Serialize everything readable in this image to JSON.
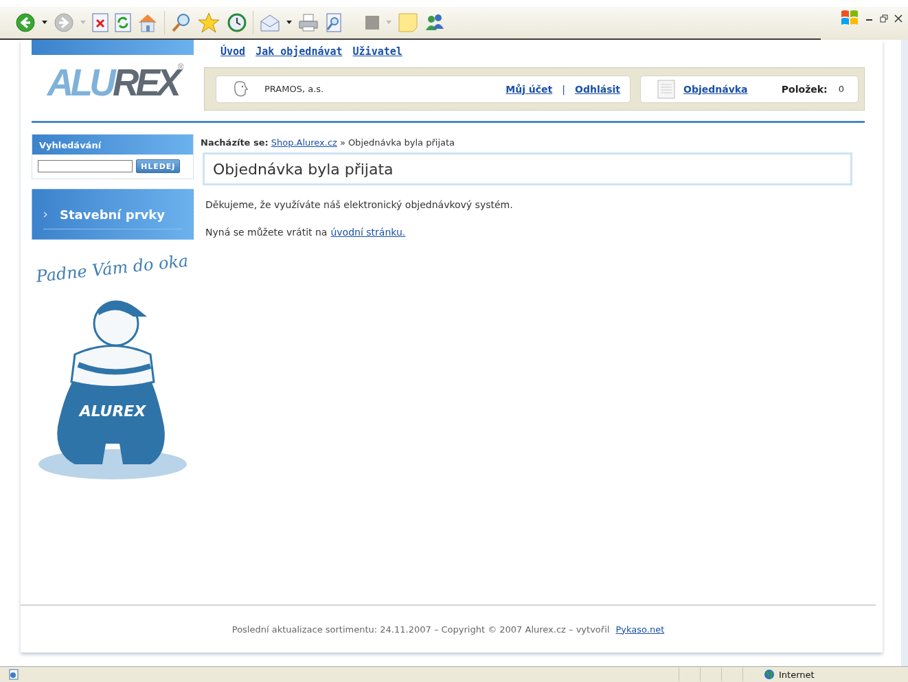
{
  "nav_links": [
    "Úvod",
    "Jak objednávat",
    "Uživatel"
  ],
  "logo": {
    "light_part": "ALU",
    "dark_part": "REX",
    "mark": "®"
  },
  "user_panel": {
    "company": "PRAMOS, a.s.",
    "links": [
      "Můj účet",
      "Odhlásit"
    ],
    "separator": "|"
  },
  "order_panel": {
    "link": "Objednávka",
    "count_label": "Položek:",
    "count": "0"
  },
  "search": {
    "title": "Vyhledávání",
    "button": "HLEDEJ"
  },
  "categories": [
    {
      "label": "Stavební prvky"
    }
  ],
  "slogan": "Padne Vám do oka",
  "mascot_text": "ALUREX",
  "breadcrumb": {
    "label": "Nacházíte se:",
    "link": "Shop.Alurex.cz",
    "separator": "»",
    "current": "Objednávka byla přijata"
  },
  "page_title": "Objednávka byla přijata",
  "paragraphs": [
    {
      "text": "Děkujeme, že využíváte náš elektronický objednávkový systém."
    },
    {
      "text": "Nyná se můžete vrátit na",
      "link": "úvodní stránku."
    }
  ],
  "footer": {
    "text": "Poslední aktualizace sortimentu: 24.11.2007 – Copyright © 2007 Alurex.cz – vytvořil",
    "link": "Pykaso.net"
  },
  "status_bar": {
    "zone": "Internet"
  }
}
